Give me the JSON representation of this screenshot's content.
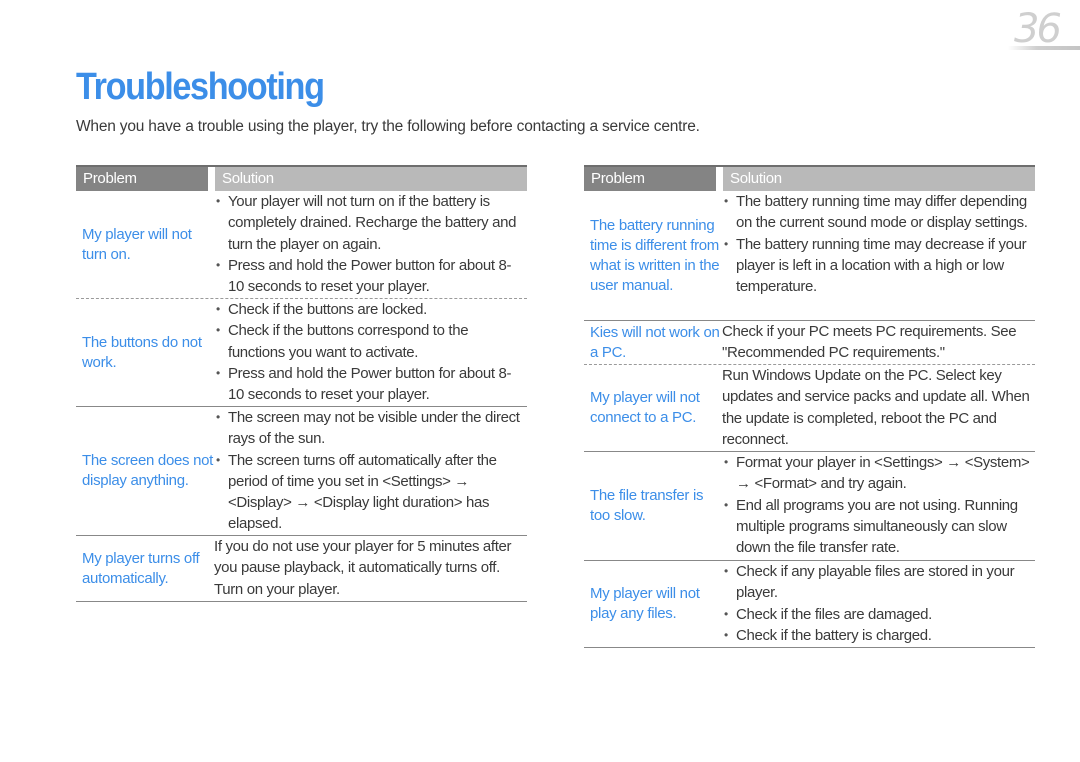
{
  "page": {
    "number": "36",
    "title": "Troubleshooting",
    "intro": "When you have a trouble using the player, try the following before contacting a service centre.",
    "accent_color": "#3c8ee8"
  },
  "tables": [
    {
      "headers": {
        "problem": "Problem",
        "solution": "Solution"
      },
      "rows": [
        {
          "problem": "My player will not turn on.",
          "solution_type": "bullets",
          "solution": [
            "Your player will not turn on if the battery is completely drained. Recharge the battery and turn the player on again.",
            "Press and hold the Power button for about 8-10 seconds to reset your player."
          ]
        },
        {
          "problem": "The buttons do not work.",
          "solution_type": "bullets",
          "solution": [
            "Check if the buttons are locked.",
            "Check if the buttons correspond to the functions you want to activate.",
            "Press and hold the Power button for about 8-10 seconds to reset your player."
          ]
        },
        {
          "problem": "The screen does not display anything.",
          "solution_type": "bullets",
          "solution": [
            "The screen may not be visible under the direct rays of the sun.",
            "The screen turns off automatically after the period of time you set in <Settings> → <Display> → <Display light duration> has elapsed."
          ]
        },
        {
          "problem": "My player turns off automatically.",
          "solution_type": "text",
          "solution": "If you do not use your player for 5 minutes after you pause playback, it automatically turns off. Turn on your player."
        }
      ]
    },
    {
      "headers": {
        "problem": "Problem",
        "solution": "Solution"
      },
      "rows": [
        {
          "problem": "The battery running time is different from what is written in the user manual.",
          "solution_type": "bullets",
          "solution": [
            "The battery running time may differ depending on the current sound mode or display settings.",
            "The battery running time may decrease if your player is left in a location with a high or low temperature."
          ]
        },
        {
          "problem": "Kies will not work on a PC.",
          "solution_type": "text",
          "solution": "Check if your PC meets PC requirements. See \"Recommended PC requirements.\""
        },
        {
          "problem": "My player will not connect to a PC.",
          "solution_type": "text",
          "solution": "Run Windows Update on the PC. Select key updates and service packs and update all. When the update is completed, reboot the PC and reconnect."
        },
        {
          "problem": "The file transfer is too slow.",
          "solution_type": "bullets",
          "solution": [
            "Format your player in <Settings> → <System> → <Format> and try again.",
            "End all programs you are not using. Running multiple programs simultaneously can slow down the file transfer rate."
          ]
        },
        {
          "problem": "My player will not play any files.",
          "solution_type": "bullets",
          "solution": [
            "Check if any playable files are stored in your player.",
            "Check if the files are damaged.",
            "Check if the battery is charged."
          ]
        }
      ]
    }
  ]
}
